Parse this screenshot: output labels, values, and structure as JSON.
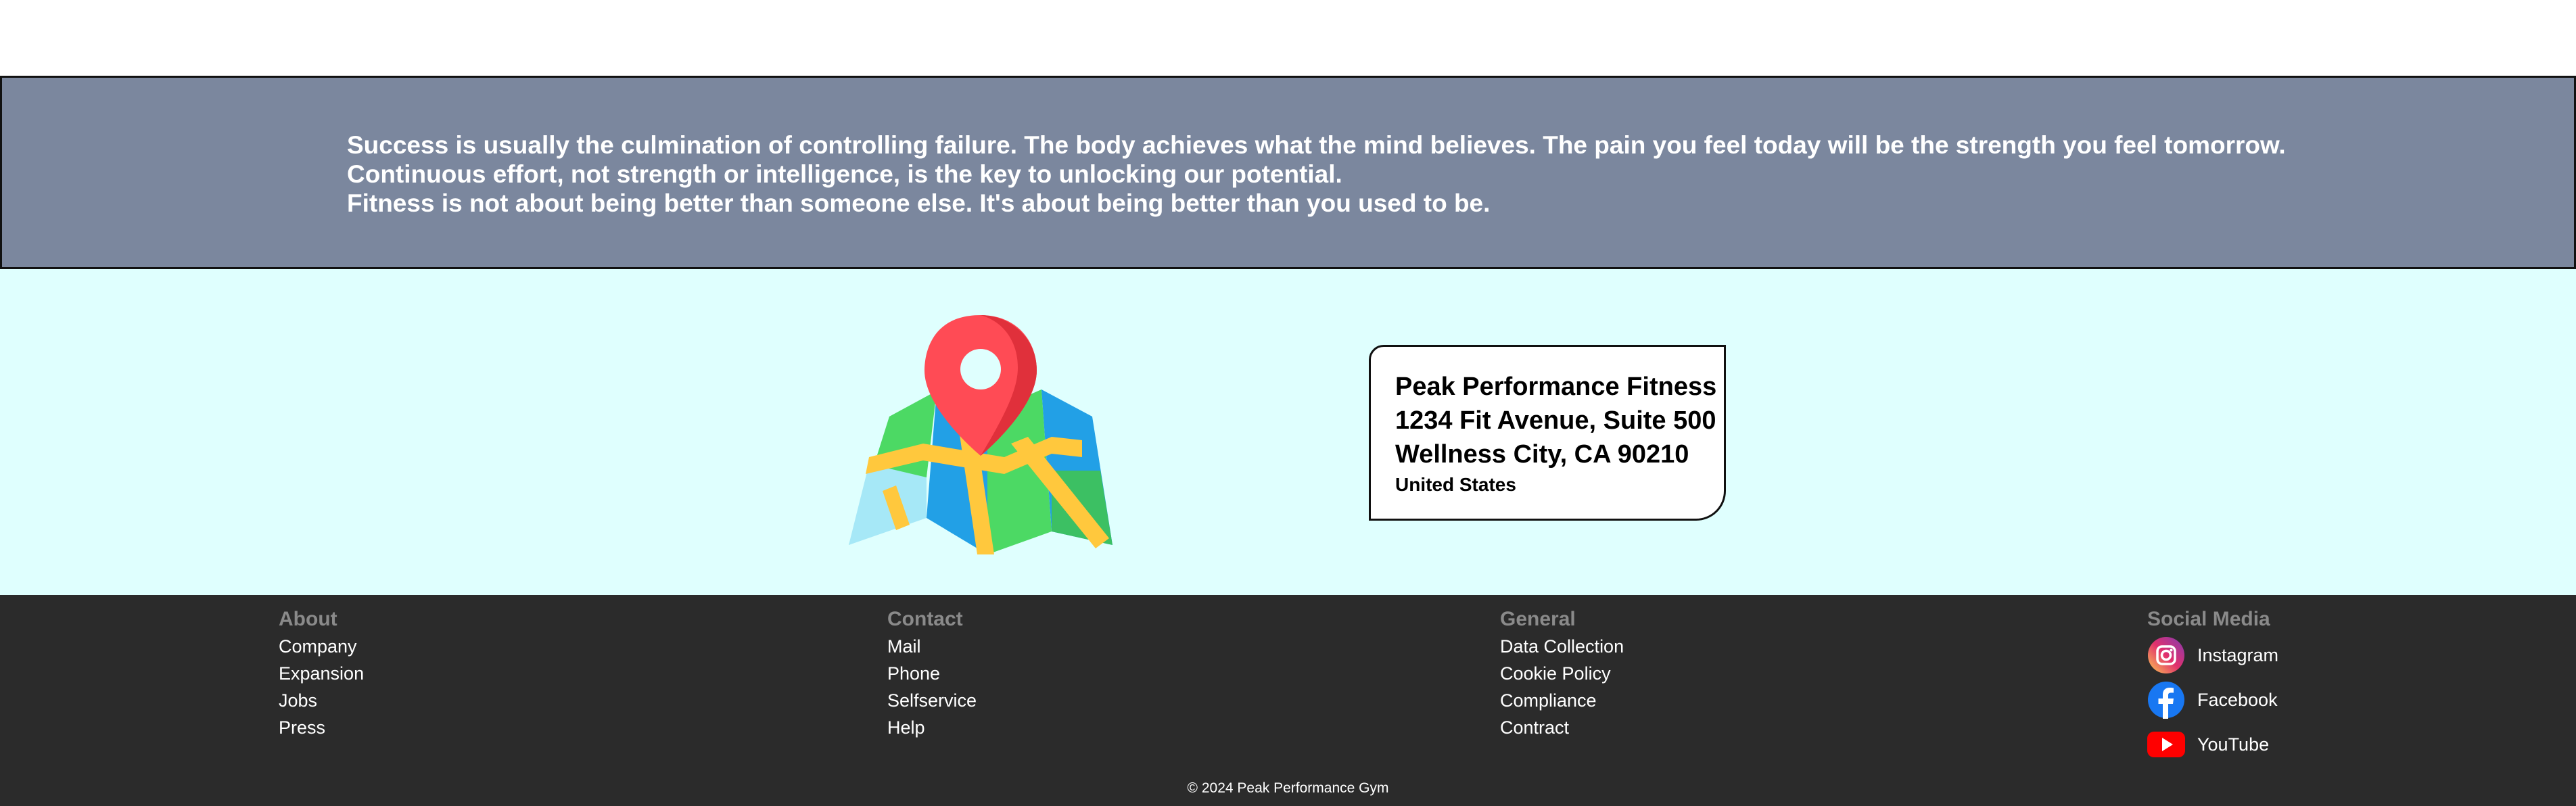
{
  "quotes": [
    "Success is usually the culmination of controlling failure. The body achieves what the mind believes. The pain you feel today will be the strength you feel tomorrow.",
    "Continuous effort, not strength or intelligence, is the key to unlocking our potential.",
    "Fitness is not about being better than someone else. It's about being better than you used to be."
  ],
  "address": {
    "name": "Peak Performance Fitness",
    "street": "1234 Fit Avenue, Suite 500",
    "city": "Wellness City, CA 90210",
    "country": "United States"
  },
  "footer": {
    "about": {
      "title": "About",
      "links": [
        "Company",
        "Expansion",
        "Jobs",
        "Press"
      ]
    },
    "contact": {
      "title": "Contact",
      "links": [
        "Mail",
        "Phone",
        "Selfservice",
        "Help"
      ]
    },
    "general": {
      "title": "General",
      "links": [
        "Data Collection",
        "Cookie Policy",
        "Compliance",
        "Contract"
      ]
    },
    "social": {
      "title": "Social Media",
      "links": [
        {
          "label": "Instagram",
          "icon": "instagram-icon"
        },
        {
          "label": "Facebook",
          "icon": "facebook-icon"
        },
        {
          "label": "YouTube",
          "icon": "youtube-icon"
        }
      ]
    },
    "copyright": "© 2024 Peak Performance Gym"
  },
  "colors": {
    "quote_band": "#7b879e",
    "location_band": "#dffffe",
    "footer_bg": "#2b2b2b",
    "footer_title": "#8a8a8a"
  }
}
